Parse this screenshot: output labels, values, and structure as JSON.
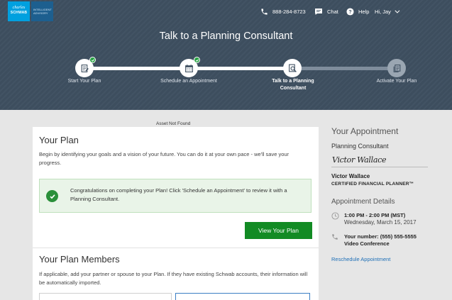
{
  "brand": {
    "logo_line1": "charles",
    "logo_line2": "SCHWAB",
    "advisory_line1": "INTELLIGENT",
    "advisory_line2": "ADVISORY"
  },
  "topnav": {
    "phone": "888-284-8723",
    "chat": "Chat",
    "help": "Help",
    "user": "Hi, Jay"
  },
  "page_title": "Talk to a Planning Consultant",
  "steps": [
    {
      "label": "Start Your Plan",
      "status": "complete"
    },
    {
      "label": "Schedule an Appointment",
      "status": "complete"
    },
    {
      "label": "Talk to a Planning Consultant",
      "status": "active"
    },
    {
      "label": "Activate Your Plan",
      "status": "upcoming"
    }
  ],
  "asset_not_found": "Asset Not Found",
  "plan": {
    "title": "Your Plan",
    "intro": "Begin by identifying your goals and a vision of your future. You can do it at your own pace - we'll save your progress.",
    "congrats": "Congratulations on completing your Plan! Click 'Schedule an Appointment' to review it with a Planning Consultant.",
    "view_button": "View Your Plan"
  },
  "members": {
    "title": "Your Plan Members",
    "text": "If applicable, add your partner or spouse to your Plan. If they have existing Schwab accounts, their information will be automatically imported."
  },
  "appointment": {
    "title": "Your Appointment",
    "role": "Planning Consultant",
    "signature": "Victor Wallace",
    "name": "Victor Wallace",
    "credential": "CERTIFIED FINANCIAL PLANNER™",
    "details_title": "Appointment Details",
    "time": "1:00 PM - 2:00 PM (MST)",
    "date": "Wednesday, March 15, 2017",
    "number": "Your number: (555) 555-5555",
    "method": "Video Conference",
    "reschedule": "Reschedule Appointment"
  },
  "colors": {
    "header_bg": "#3e4f60",
    "primary_green": "#128b24",
    "link_blue": "#1e6fb7",
    "success_bg": "#e9f4e8"
  }
}
